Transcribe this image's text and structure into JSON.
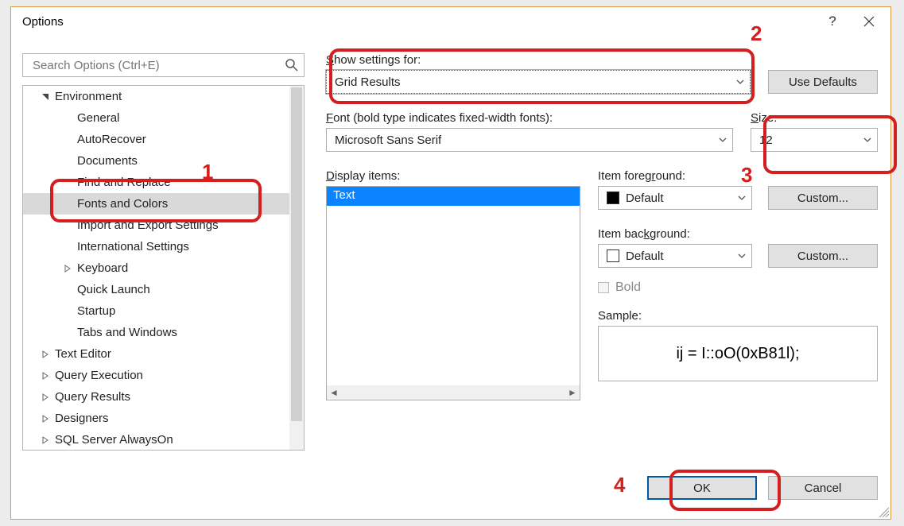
{
  "title": "Options",
  "search": {
    "placeholder": "Search Options (Ctrl+E)"
  },
  "tree": {
    "nodes": [
      {
        "label": "Environment",
        "depth": 0,
        "exp": "open",
        "children": true
      },
      {
        "label": "General",
        "depth": 1
      },
      {
        "label": "AutoRecover",
        "depth": 1
      },
      {
        "label": "Documents",
        "depth": 1
      },
      {
        "label": "Find and Replace",
        "depth": 1
      },
      {
        "label": "Fonts and Colors",
        "depth": 1,
        "selected": true
      },
      {
        "label": "Import and Export Settings",
        "depth": 1
      },
      {
        "label": "International Settings",
        "depth": 1
      },
      {
        "label": "Keyboard",
        "depth": 1,
        "exp": "closed",
        "children": true
      },
      {
        "label": "Quick Launch",
        "depth": 1
      },
      {
        "label": "Startup",
        "depth": 1
      },
      {
        "label": "Tabs and Windows",
        "depth": 1
      },
      {
        "label": "Text Editor",
        "depth": 0,
        "exp": "closed",
        "children": true
      },
      {
        "label": "Query Execution",
        "depth": 0,
        "exp": "closed",
        "children": true
      },
      {
        "label": "Query Results",
        "depth": 0,
        "exp": "closed",
        "children": true
      },
      {
        "label": "Designers",
        "depth": 0,
        "exp": "closed",
        "children": true
      },
      {
        "label": "SQL Server AlwaysOn",
        "depth": 0,
        "exp": "closed",
        "children": true
      }
    ]
  },
  "labels": {
    "show_settings": "Show settings for:",
    "font": "Font (bold type indicates fixed-width fonts):",
    "size": "Size:",
    "display_items": "Display items:",
    "item_fg": "Item foreground:",
    "item_bg": "Item background:",
    "bold": "Bold",
    "sample": "Sample:"
  },
  "values": {
    "show_settings": "Grid Results",
    "font": "Microsoft Sans Serif",
    "size": "12",
    "fg": "Default",
    "bg": "Default",
    "sample": "ij = I::oO(0xB81l);"
  },
  "display_items": [
    "Text"
  ],
  "buttons": {
    "use_defaults": "Use Defaults",
    "custom_fg": "Custom...",
    "custom_bg": "Custom...",
    "ok": "OK",
    "cancel": "Cancel"
  },
  "annotations": {
    "1": "1",
    "2": "2",
    "3": "3",
    "4": "4"
  }
}
